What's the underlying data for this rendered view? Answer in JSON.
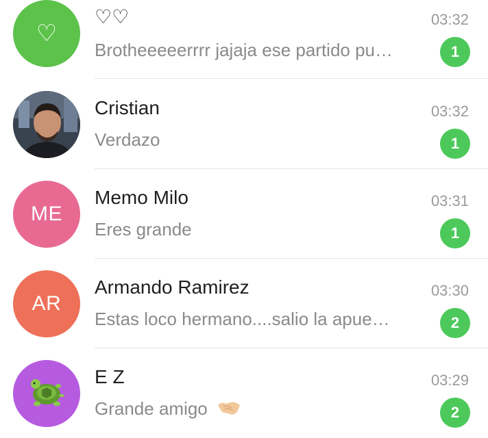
{
  "chats": [
    {
      "name": "♡♡",
      "preview": "Brotheeeeerrrr jajaja ese partido pu…",
      "time": "03:32",
      "unread": "1",
      "avatar_type": "icon",
      "avatar_icon": "heart-icon",
      "avatar_glyph": "♡",
      "avatar_color": "#5cc24a"
    },
    {
      "name": "Cristian",
      "preview": "Verdazo",
      "time": "03:32",
      "unread": "1",
      "avatar_type": "photo"
    },
    {
      "name": "Memo Milo",
      "preview": "Eres grande",
      "time": "03:31",
      "unread": "1",
      "avatar_type": "initials",
      "avatar_initials": "ME",
      "avatar_color": "#e86a93"
    },
    {
      "name": "Armando Ramirez",
      "preview": "Estas loco hermano....salio la apue…",
      "time": "03:30",
      "unread": "2",
      "avatar_type": "initials",
      "avatar_initials": "AR",
      "avatar_color": "#ee7058"
    },
    {
      "name": "E Z",
      "preview": "Grande amigo",
      "preview_emoji": "handshake-icon",
      "time": "03:29",
      "unread": "2",
      "avatar_type": "emoji",
      "avatar_icon": "turtle-icon",
      "avatar_color": "#b65be0"
    }
  ],
  "colors": {
    "unread_badge": "#4cc95a",
    "name_text": "#1f1f1f",
    "preview_text": "#8a8a8a",
    "time_text": "#9a9a9a"
  }
}
